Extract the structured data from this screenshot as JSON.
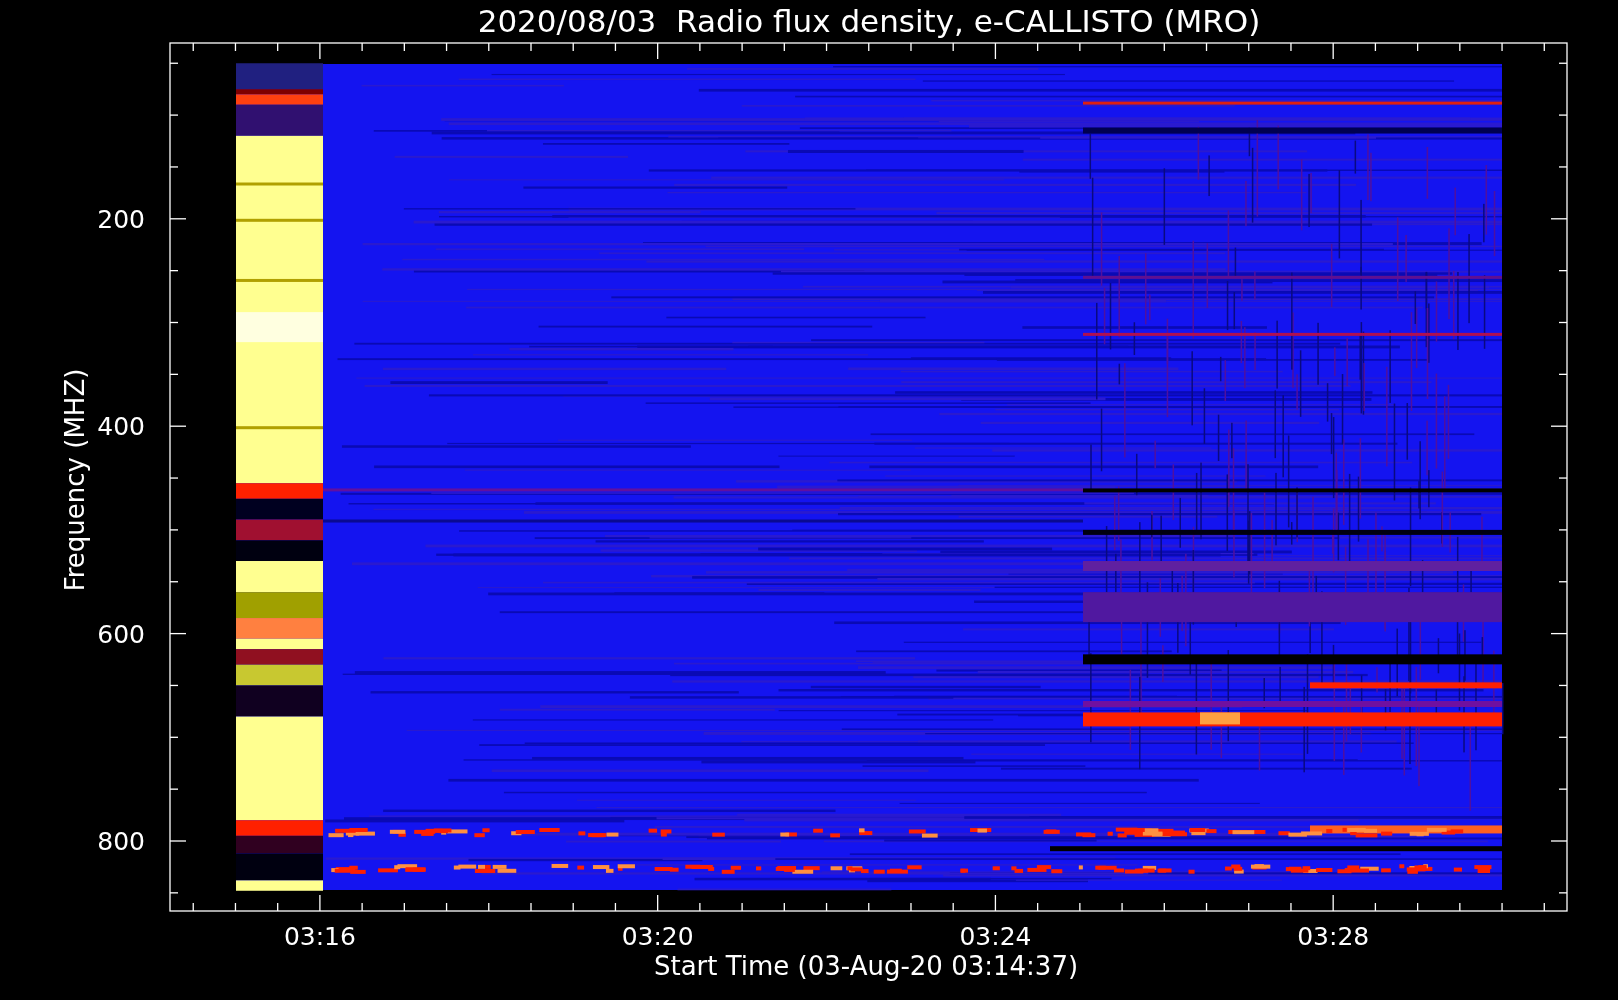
{
  "title": "2020/08/03  Radio flux density, e-CALLISTO (MRO)",
  "y_axis": {
    "label": "Frequency (MHZ)",
    "ticks": [
      "200",
      "400",
      "600",
      "800"
    ]
  },
  "x_axis": {
    "label": "Start Time (03-Aug-20 03:14:37)",
    "ticks": [
      "03:16",
      "03:20",
      "03:24",
      "03:28"
    ]
  }
}
